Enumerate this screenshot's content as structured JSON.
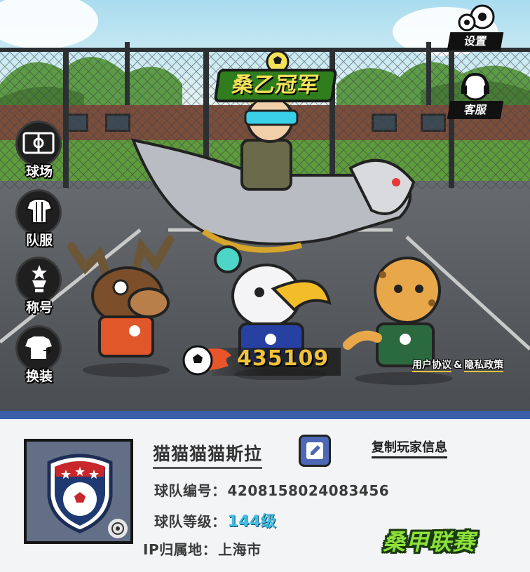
{
  "game": {
    "event_logo": "桑乙冠军",
    "score": "435109",
    "policy": {
      "user_agreement": "用户协议",
      "amp": "&",
      "privacy": "隐私政策"
    }
  },
  "top_menu": {
    "settings": "设置",
    "support": "客服"
  },
  "side_menu": {
    "items": [
      {
        "label": "球场",
        "icon": "pitch-icon"
      },
      {
        "label": "队服",
        "icon": "jersey-swap-icon"
      },
      {
        "label": "称号",
        "icon": "trophy-icon"
      },
      {
        "label": "换装",
        "icon": "shirt-swap-icon"
      }
    ]
  },
  "profile": {
    "player_name": "猫猫猫猫斯拉",
    "copy_label": "复制玩家信息",
    "team_id_label": "球队编号：",
    "team_id": "4208158024083456",
    "team_level_label": "球队等级：",
    "team_level": "144级",
    "ip_label": "IP归属地：",
    "ip_location": "上海市",
    "league_logo": "桑甲联赛"
  },
  "colors": {
    "panel_edge": "#3b5ca8",
    "edit_button": "#4d69b5",
    "score": "#f2c33a",
    "level": "#41bde6",
    "league": "#8de03a"
  }
}
